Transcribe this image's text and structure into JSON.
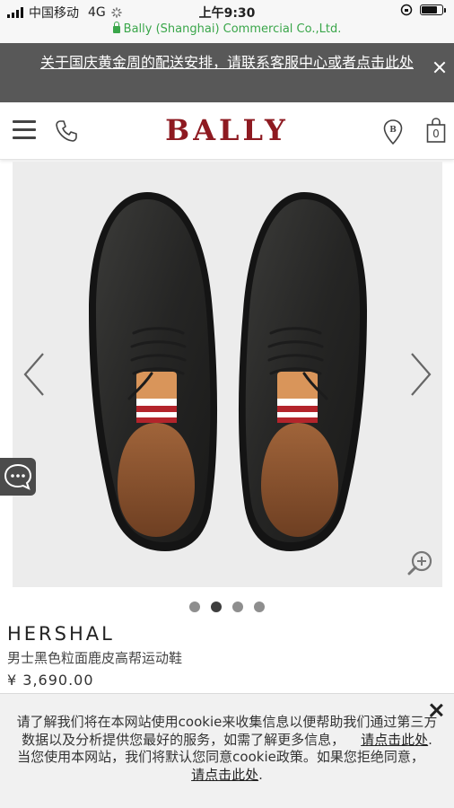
{
  "status_bar": {
    "carrier": "中国移动",
    "network": "4G",
    "time": "上午9:30",
    "url_label": "Bally (Shanghai) Commercial Co.,Ltd.",
    "battery_level": 0.8
  },
  "notice": {
    "text": "关于国庆黄金周的配送安排，请联系客服中心或者点击此处"
  },
  "header": {
    "logo": "BALLY",
    "bag_count": "0",
    "icons": [
      "menu-icon",
      "phone-icon",
      "store-locator-icon",
      "shopping-bag-icon"
    ]
  },
  "gallery": {
    "slide_count": 4,
    "active_index": 1,
    "icons": [
      "chevron-left-icon",
      "chevron-right-icon",
      "zoom-in-icon",
      "chat-icon"
    ]
  },
  "product": {
    "name": "HERSHAL",
    "description": "男士黑色粒面鹿皮高帮运动鞋",
    "price": "¥ 3,690.00"
  },
  "cookie": {
    "text_1": "请了解我们将在本网站使用cookie来收集信息以便帮助我们通过第三方数据以及分析提供您最好的服务，如需了解更多信息，",
    "link_1": "请点击此处",
    "text_2": ". 当您使用本网站，我们将默认您同意cookie政策。如果您拒绝同意，",
    "link_2": "请点击此处",
    "text_3": "."
  },
  "colors": {
    "brand": "#8e1a21",
    "secure_green": "#3aa64a",
    "notice_bg": "#585858"
  }
}
